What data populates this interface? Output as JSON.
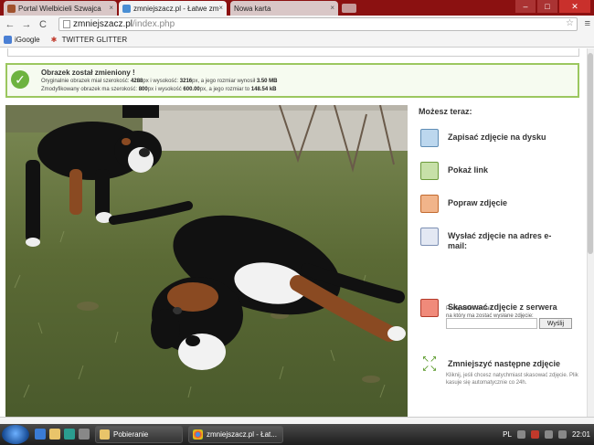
{
  "browser": {
    "tabs": [
      {
        "label": "Portal Wielbicieli Szwajca",
        "icon": "site-icon"
      },
      {
        "label": "zmniejszacz.pl - Łatwe zm",
        "icon": "site-icon"
      },
      {
        "label": "Nowa karta",
        "icon": ""
      }
    ],
    "tab_close": "×",
    "url_host": "zmniejszacz.pl",
    "url_path": "/index.php",
    "bookmarks": [
      {
        "label": "iGoogle",
        "icon": "google-icon"
      },
      {
        "label": "TWITTER GLITTER",
        "icon": "glitter-icon"
      }
    ],
    "window_buttons": {
      "minimize": "–",
      "maximize": "□",
      "close": "✕"
    },
    "nav": {
      "back": "←",
      "forward": "→",
      "reload": "C"
    }
  },
  "notice": {
    "title": "Obrazek został zmieniony !",
    "line1_prefix": "Oryginalnie obrazek miał szerokość: ",
    "orig_width": "4288",
    "line1_mid1": "px i wysokość: ",
    "orig_height": "3216",
    "line1_mid2": "px, a jego rozmiar wynosił ",
    "orig_size": "3.50 MB",
    "line2_prefix": "Zmodyfikowany obrazek ma szerokość: ",
    "new_width": "800",
    "line2_mid1": "px i wysokość ",
    "new_height": "600.00",
    "line2_mid2": "px, a jego rozmiar to ",
    "new_size": "148.54 kB"
  },
  "sidebar": {
    "heading": "Możesz teraz:",
    "actions": [
      {
        "label": "Zapisać zdjęcie na dysku",
        "icon": "save-disk-icon"
      },
      {
        "label": "Pokaż link",
        "icon": "link-icon"
      },
      {
        "label": "Popraw zdjęcie",
        "icon": "edit-photo-icon"
      },
      {
        "label": "Wysłać zdjęcie na adres e-mail:",
        "icon": "email-icon"
      },
      {
        "label": "Skasować zdjęcie z serwera",
        "icon": "delete-icon"
      },
      {
        "label": "Zmniejszyć następne zdjęcie",
        "icon": "resize-arrows-icon"
      }
    ],
    "mail_hint_1": "Podaj adres e-mail,",
    "mail_hint_2": "na który ma zostać wysłane zdjęcie:",
    "mail_placeholder": "",
    "mail_button": "Wyślij",
    "delete_note_1": "Kliknij, jeśli chcesz natychmiast skasować zdjęcie. Plik",
    "delete_note_2": "kasuje się automatycznie co 24h."
  },
  "photo": {
    "subject": "two dogs on grass",
    "colors": {
      "grass": "#5e6b3a",
      "dog_black": "#111111",
      "dog_brown": "#8a4a22",
      "dog_white": "#f2f2f2"
    }
  },
  "taskbar": {
    "tasks": [
      {
        "label": "Pobieranie",
        "icon": "folder-icon"
      },
      {
        "label": "zmniejszacz.pl - Łat...",
        "icon": "chrome-icon"
      }
    ],
    "language": "PL",
    "clock": "22:01"
  },
  "colors": {
    "chrome_frame": "#8b1111",
    "notice_border": "#9bc75f",
    "notice_check": "#6db33f"
  }
}
